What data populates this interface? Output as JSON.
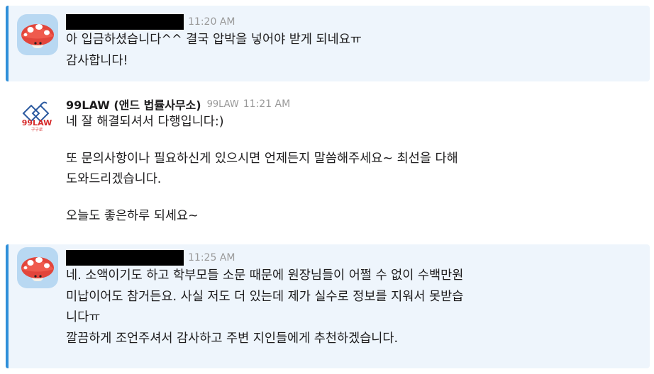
{
  "messages": [
    {
      "time": "11:20 AM",
      "lines": [
        "아 입금하셨습니다^^ 결국 압박을 넣어야 받게 되네요ㅠ",
        "감사합니다!"
      ]
    },
    {
      "sender": "99LAW (앤드 법률사무소)",
      "app_label": "99LAW",
      "time": "11:21 AM",
      "logo": {
        "brand": "99LAW",
        "sub": "구구로"
      },
      "paragraphs": [
        [
          "네 잘 해결되셔서 다행입니다:)"
        ],
        [
          "또 문의사항이나 필요하신게 있으시면 언제든지 말씀해주세요~ 최선을 다해",
          "도와드리겠습니다."
        ],
        [
          "오늘도 좋은하루 되세요~"
        ]
      ]
    },
    {
      "time": "11:25 AM",
      "lines": [
        "네. 소액이기도 하고 학부모들 소문 때문에 원장님들이 어쩔 수 없이 수백만원",
        "미납이어도 참거든요. 사실 저도 더 있는데 제가 실수로 정보를 지워서 못받습",
        "니다ㅠ",
        "깔끔하게 조언주셔서 감사하고 주변 지인들에게 추천하겠습니다."
      ]
    }
  ],
  "colors": {
    "highlight_bg": "#eef5fc",
    "highlight_bar": "#2f8fd9",
    "meta_text": "#9a9a9a",
    "logo_red": "#d62b2b",
    "logo_blue": "#2c5aa0"
  },
  "icons": {
    "user_avatar": "mushroom-icon",
    "lawfirm_avatar": "99law-logo"
  }
}
